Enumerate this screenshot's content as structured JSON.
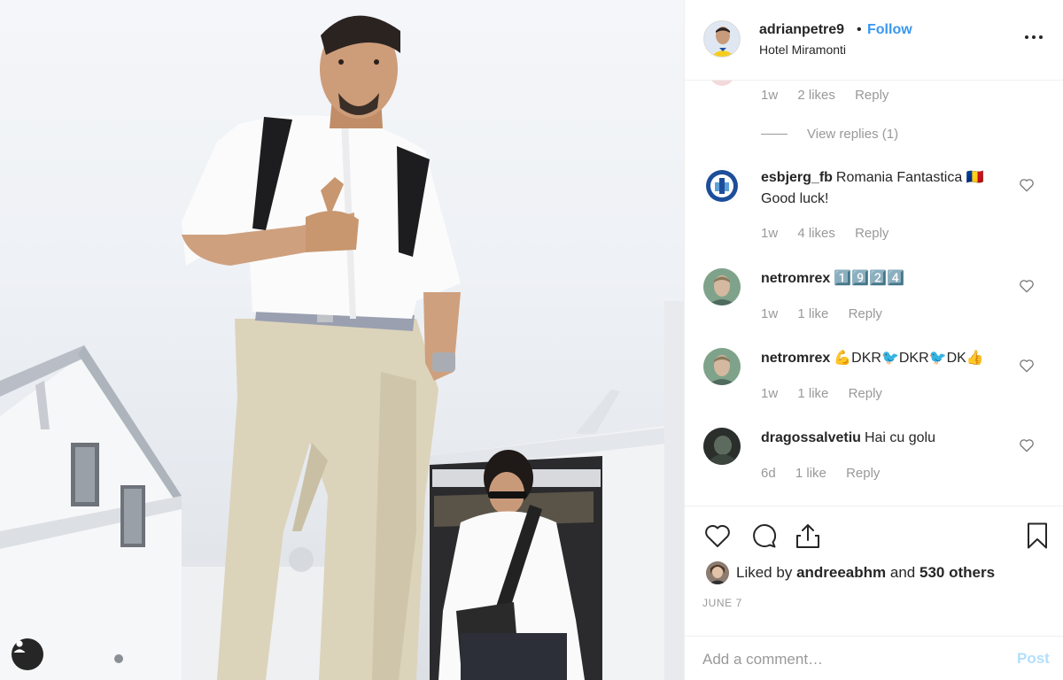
{
  "post": {
    "username": "adrianpetre9",
    "separator": "•",
    "follow_label": "Follow",
    "location": "Hotel Miramonti"
  },
  "comments": {
    "partial_meta": {
      "time": "1w",
      "likes": "2 likes",
      "reply": "Reply"
    },
    "view_replies": "View replies (1)",
    "items": [
      {
        "username": "esbjerg_fb",
        "text": "Romania Fantastica 🇷🇴 Good luck!",
        "time": "1w",
        "likes": "4 likes",
        "reply": "Reply"
      },
      {
        "username": "netromrex",
        "text": "1️⃣9️⃣2️⃣4️⃣",
        "time": "1w",
        "likes": "1 like",
        "reply": "Reply"
      },
      {
        "username": "netromrex",
        "text": "💪DKR🐦DKR🐦DK👍",
        "time": "1w",
        "likes": "1 like",
        "reply": "Reply"
      },
      {
        "username": "dragossalvetiu",
        "text": "Hai cu golu",
        "time": "6d",
        "likes": "1 like",
        "reply": "Reply"
      }
    ]
  },
  "actions": {
    "icons": [
      "heart-icon",
      "comment-icon",
      "share-icon",
      "bookmark-icon"
    ],
    "liked_by_prefix": "Liked by",
    "liked_by_user": "andreeabhm",
    "liked_by_and": "and",
    "liked_by_others": "530 others",
    "date": "JUNE 7"
  },
  "add_comment": {
    "placeholder": "Add a comment…",
    "post_label": "Post"
  },
  "colors": {
    "link_blue": "#3897f0",
    "post_disabled": "#b2dffc",
    "muted_text": "#999999",
    "text": "#262626"
  }
}
